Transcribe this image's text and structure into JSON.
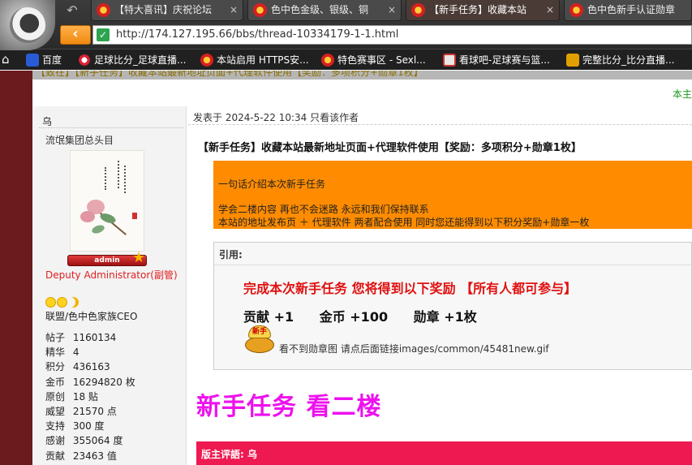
{
  "browser": {
    "tabs": [
      {
        "label": "【特大喜讯】庆祝论坛",
        "active": false
      },
      {
        "label": "色中色金级、银级、铜",
        "active": false
      },
      {
        "label": "【新手任务】收藏本站",
        "active": true
      },
      {
        "label": "色中色新手认证勋章",
        "active": false
      }
    ],
    "tab_close_glyph": "×",
    "url": "http://174.127.195.66/bbs/thread-10334179-1-1.html",
    "accent_color": "#f08a10"
  },
  "bookmarks": [
    {
      "label": "百度",
      "icon": "paw-icon",
      "color": "#2a5bd7"
    },
    {
      "label": "足球比分_足球直播...",
      "icon": "ball-icon",
      "color": "#d23"
    },
    {
      "label": "本站启用 HTTPS安...",
      "icon": "site-icon",
      "color": "#d62020"
    },
    {
      "label": "特色赛事区 - Sexl...",
      "icon": "site-icon",
      "color": "#d62020"
    },
    {
      "label": "看球吧-足球赛与篮...",
      "icon": "tv-icon",
      "color": "#e8e8e8"
    },
    {
      "label": "完整比分_比分直播...",
      "icon": "score-icon",
      "color": "#e0a000"
    }
  ],
  "page": {
    "banner_text": "【致在】【新手任务】收藏本站最新地址页面+代理软件使用【奖励：多项积分+勋章1枚】",
    "right_link": "本主",
    "author": {
      "name": "乌",
      "title": "流氓集团总头目",
      "badge": "admin",
      "group": "Deputy Administrator(副管)",
      "family": "联盟/色中色家族CEO",
      "stats": [
        {
          "key": "帖子",
          "value": "1160134"
        },
        {
          "key": "精华",
          "value": "4"
        },
        {
          "key": "积分",
          "value": "436163"
        },
        {
          "key": "金币",
          "value": "16294820 枚"
        },
        {
          "key": "原创",
          "value": "18 贴"
        },
        {
          "key": "威望",
          "value": "21570 点"
        },
        {
          "key": "支持",
          "value": "300 度"
        },
        {
          "key": "感谢",
          "value": "355064 度"
        },
        {
          "key": "贡献",
          "value": "23463 值"
        }
      ]
    },
    "post": {
      "meta": "发表于 2024-5-22 10:34  只看该作者",
      "title": "【新手任务】收藏本站最新地址页面+代理软件使用【奖励：多项积分+勋章1枚】",
      "intro_lines": [
        "一句话介绍本次新手任务",
        "学会二楼内容  再也不会迷路 永远和我们保持联系",
        "本站的地址发布页 ＋  代理软件    两者配合使用   同时您还能得到以下积分奖励+勋章一枚"
      ],
      "quote_label": "引用:",
      "reward_heading": "完成本次新手任务  您将得到以下奖励  【所有人都可参与】",
      "rewards": [
        "贡献 +1",
        "金币 +100",
        "勋章 +1枚"
      ],
      "medal_badge_text": "新手",
      "medal_missing_text": "看不到勋章图 请点后面链接images/common/45481new.gif",
      "big_text": "新手任务   看二楼",
      "mod_comment_label": "版主评語: 乌"
    }
  }
}
